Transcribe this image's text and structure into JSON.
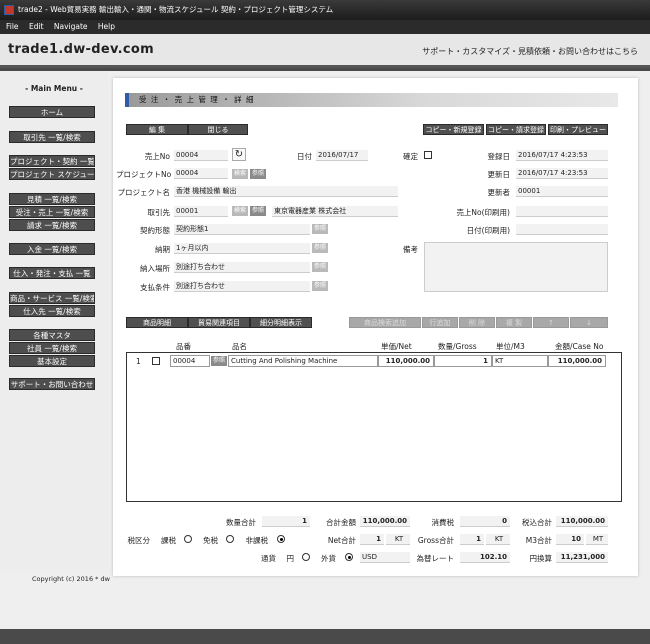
{
  "window": {
    "title": "trade2 - Web貿易実務 輸出輸入・通関・物流スケジュール 契約・プロジェクト管理システム"
  },
  "menu": [
    "File",
    "Edit",
    "Navigate",
    "Help"
  ],
  "header": {
    "site": "trade1.dw-dev.com",
    "support": "サポート・カスタマイズ・見積依頼・お問い合わせはこちら"
  },
  "sidebar": {
    "title": "- Main Menu -",
    "items": [
      "ホーム",
      "取引先 一覧/検索",
      "プロジェクト・契約 一覧",
      "プロジェクト スケジュール",
      "見積 一覧/検索",
      "受注・売上 一覧/検索",
      "請求 一覧/検索",
      "入金 一覧/検索",
      "仕入・発注・支払 一覧",
      "商品・サービス 一覧/検索",
      "仕入先 一覧/検索",
      "各種マスタ",
      "社員 一覧/検索",
      "基本設定",
      "サポート・お問い合わせ"
    ]
  },
  "page": {
    "title": "受 注 ・ 売 上 管 理 ・ 詳 細"
  },
  "toolbar": {
    "edit": "編 集",
    "close": "閉じる",
    "copy_new": "コピー・新規登録",
    "copy_invoice": "コピー・請求登録",
    "print": "印刷・プレビュー"
  },
  "form": {
    "sales_no_label": "売上No",
    "sales_no": "00004",
    "date_label": "日付",
    "date": "2016/07/17",
    "confirm_label": "確定",
    "reg_date_label": "登録日",
    "reg_date": "2016/07/17 4:23:53",
    "upd_date_label": "更新日",
    "upd_date": "2016/07/17 4:23:53",
    "updater_label": "更新者",
    "updater": "00001",
    "project_no_label": "プロジェクトNo",
    "project_no": "00004",
    "project_name_label": "プロジェクト名",
    "project_name": "香港 機械設備 輸出",
    "client_label": "取引先",
    "client_no": "00001",
    "client_name": "東京電器産業 株式会社",
    "contract_label": "契約形態",
    "contract": "契約形態1",
    "delivery_label": "納期",
    "delivery": "1ヶ月以内",
    "place_label": "納入場所",
    "place": "別途打ち合わせ",
    "payment_label": "支払条件",
    "payment": "別途打ち合わせ",
    "sales_print_label": "売上No(印刷用)",
    "date_print_label": "日付(印刷用)",
    "remarks_label": "備考",
    "search": "検索",
    "ref": "参照"
  },
  "tabs": {
    "detail": "商品明細",
    "trade": "貿易関連項目",
    "subtotal": "細分明細表示",
    "search_add": "商品検索追加",
    "add_row": "行追加",
    "delete": "削 除",
    "copy": "複 製",
    "up": "↑",
    "down": "↓"
  },
  "table": {
    "headers": {
      "code": "品番",
      "name": "品名",
      "price": "単価/Net",
      "qty": "数量/Gross",
      "unit": "単位/M3",
      "amount": "金額/Case No"
    },
    "rows": [
      {
        "no": "1",
        "code": "00004",
        "name": "Cutting And Polishing Machine",
        "price": "110,000.00",
        "qty": "1",
        "unit": "KT",
        "amount": "110,000.00"
      }
    ]
  },
  "totals": {
    "qty_label": "数量合計",
    "qty": "1",
    "sum_label": "合計金額",
    "sum": "110,000.00",
    "tax_label": "消費税",
    "tax": "0",
    "taxin_label": "税込合計",
    "taxin": "110,000.00",
    "taxtype_label": "税区分",
    "taxable": "課税",
    "exempt": "免税",
    "nontax": "非課税",
    "net_label": "Net合計",
    "net": "1",
    "net_unit": "KT",
    "gross_label": "Gross合計",
    "gross": "1",
    "gross_unit": "KT",
    "m3_label": "M3合計",
    "m3": "10",
    "m3_unit": "MT",
    "currency_label": "通貨",
    "yen": "円",
    "foreign": "外貨",
    "currency": "USD",
    "rate_label": "為替レート",
    "rate": "102.10",
    "yen_total_label": "円換算",
    "yen_total": "11,231,000"
  },
  "footer": "Copyright (c) 2016 * dw"
}
